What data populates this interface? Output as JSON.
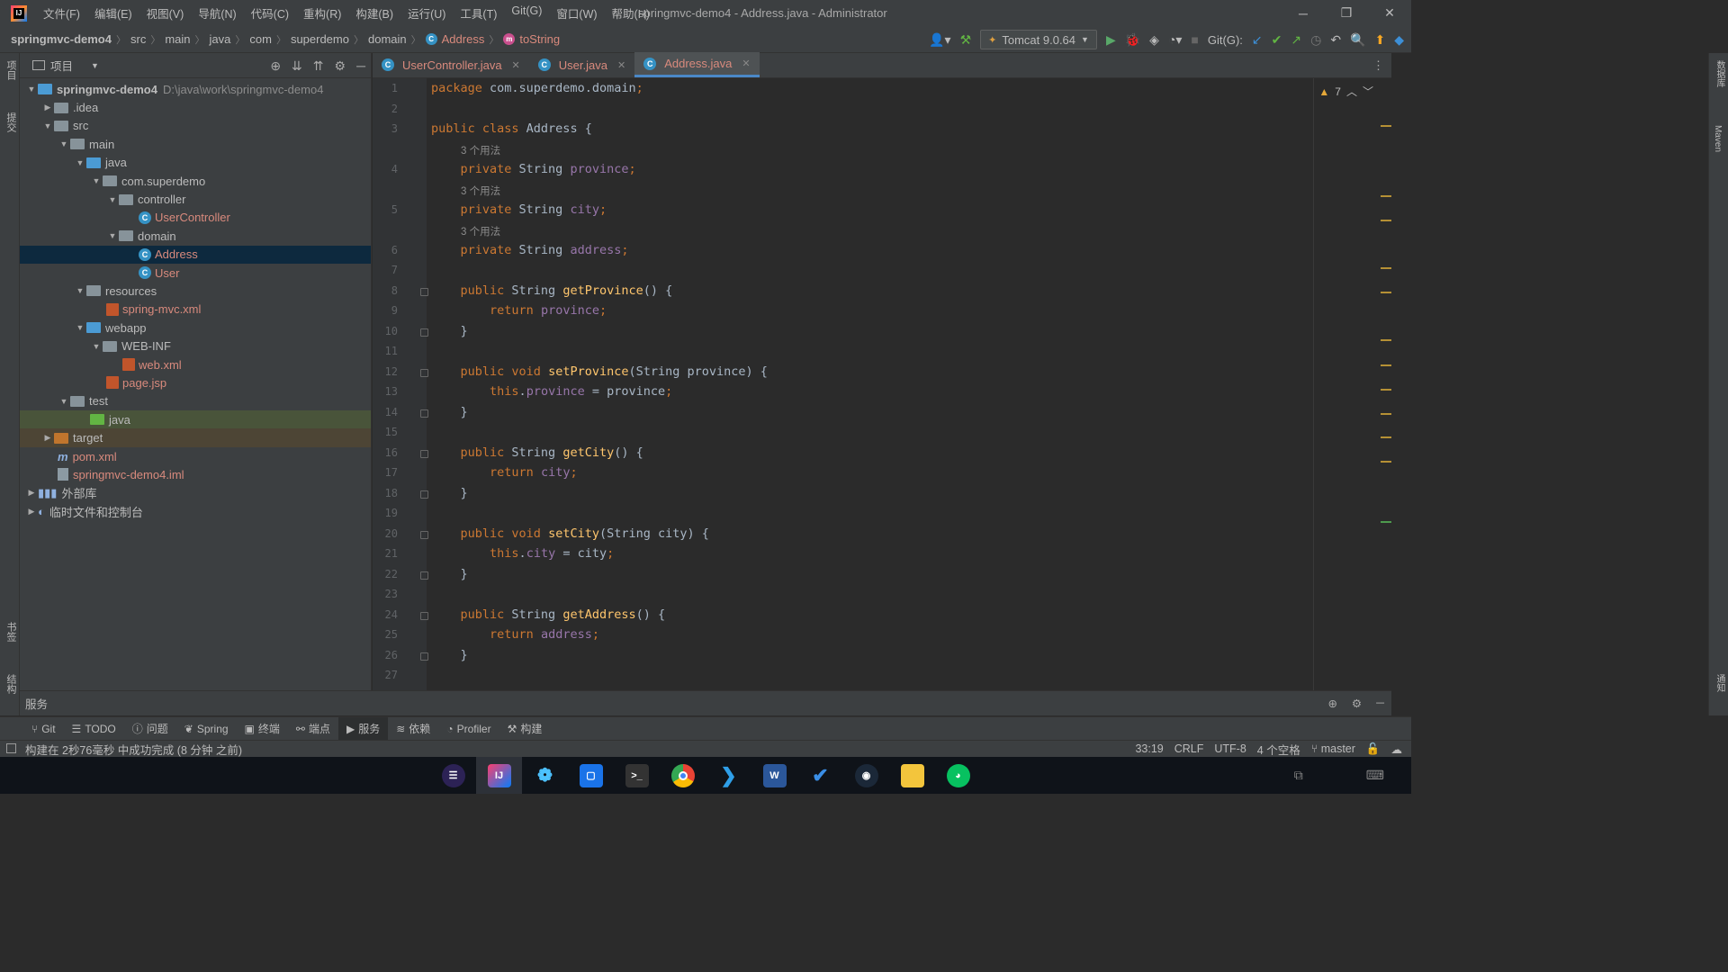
{
  "menu": [
    "文件(F)",
    "编辑(E)",
    "视图(V)",
    "导航(N)",
    "代码(C)",
    "重构(R)",
    "构建(B)",
    "运行(U)",
    "工具(T)",
    "Git(G)",
    "窗口(W)",
    "帮助(H)"
  ],
  "window_title": "springmvc-demo4 - Address.java - Administrator",
  "breadcrumb": {
    "project": "springmvc-demo4",
    "items": [
      "src",
      "main",
      "java",
      "com",
      "superdemo",
      "domain"
    ],
    "class": "Address",
    "method": "toString"
  },
  "toolbar": {
    "run_config": "Tomcat 9.0.64",
    "git_label": "Git(G):"
  },
  "left_strip": {
    "project": "项目",
    "commit": "提交",
    "bookmarks": "书签",
    "structure": "结构"
  },
  "right_strip": {
    "database": "数据库",
    "maven": "Maven",
    "notifications": "通知"
  },
  "project_panel": {
    "title": "项目"
  },
  "tree": {
    "root_name": "springmvc-demo4",
    "root_path": "D:\\java\\work\\springmvc-demo4",
    "idea": ".idea",
    "src": "src",
    "main": "main",
    "java": "java",
    "pkg": "com.superdemo",
    "controller": "controller",
    "usercontroller": "UserController",
    "domain": "domain",
    "address": "Address",
    "user": "User",
    "resources": "resources",
    "springmvc": "spring-mvc.xml",
    "webapp": "webapp",
    "webinf": "WEB-INF",
    "webxml": "web.xml",
    "pagejsp": "page.jsp",
    "test": "test",
    "testjava": "java",
    "target": "target",
    "pom": "pom.xml",
    "iml": "springmvc-demo4.iml",
    "extlib": "外部库",
    "scratches": "临时文件和控制台"
  },
  "tabs": [
    {
      "label": "UserController.java"
    },
    {
      "label": "User.java"
    },
    {
      "label": "Address.java"
    }
  ],
  "code": {
    "line1": "package com.superdemo.domain;",
    "usage": "3 个用法",
    "warnings": "7",
    "line_numbers": [
      "1",
      "2",
      "3",
      "4",
      "5",
      "6",
      "7",
      "8",
      "9",
      "10",
      "11",
      "12",
      "13",
      "14",
      "15",
      "16",
      "17",
      "18",
      "19",
      "20",
      "21",
      "22",
      "23",
      "24",
      "25",
      "26",
      "27"
    ]
  },
  "services_label": "服务",
  "tool_windows": [
    "Git",
    "TODO",
    "问题",
    "Spring",
    "终端",
    "端点",
    "服务",
    "依赖",
    "Profiler",
    "构建"
  ],
  "status": {
    "message": "构建在 2秒76毫秒 中成功完成 (8 分钟 之前)",
    "position": "33:19",
    "line_sep": "CRLF",
    "encoding": "UTF-8",
    "indent": "4 个空格",
    "branch": "master"
  },
  "colors": {
    "keyword": "#cc7832",
    "field": "#9876aa",
    "method": "#ffc66d",
    "text": "#a9b7c6",
    "selection": "#0d293e"
  }
}
